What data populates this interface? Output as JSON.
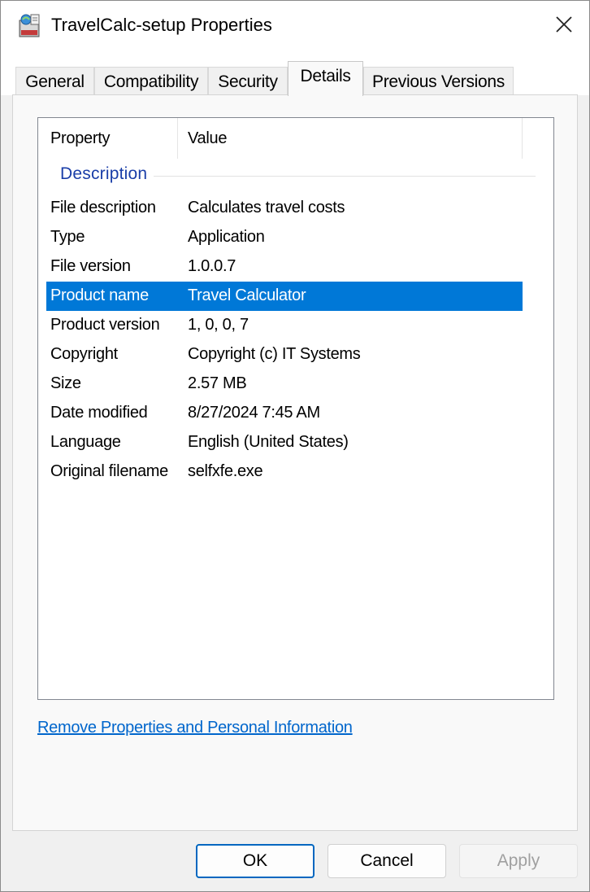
{
  "window": {
    "title": "TravelCalc-setup Properties"
  },
  "icons": {
    "app": "setup-package-icon",
    "close": "close-icon"
  },
  "tabs": [
    {
      "label": "General"
    },
    {
      "label": "Compatibility"
    },
    {
      "label": "Security"
    },
    {
      "label": "Details",
      "active": true
    },
    {
      "label": "Previous Versions"
    }
  ],
  "list": {
    "headers": {
      "property": "Property",
      "value": "Value"
    },
    "group": "Description",
    "selected_row": "Product name",
    "rows": [
      {
        "property": "File description",
        "value": "Calculates travel costs"
      },
      {
        "property": "Type",
        "value": "Application"
      },
      {
        "property": "File version",
        "value": "1.0.0.7"
      },
      {
        "property": "Product name",
        "value": "Travel Calculator"
      },
      {
        "property": "Product version",
        "value": "1, 0, 0, 7"
      },
      {
        "property": "Copyright",
        "value": "Copyright (c) IT Systems"
      },
      {
        "property": "Size",
        "value": "2.57 MB"
      },
      {
        "property": "Date modified",
        "value": "8/27/2024 7:45 AM"
      },
      {
        "property": "Language",
        "value": "English (United States)"
      },
      {
        "property": "Original filename",
        "value": "selfxfe.exe"
      }
    ]
  },
  "link": {
    "label": "Remove Properties and Personal Information"
  },
  "buttons": {
    "ok": "OK",
    "cancel": "Cancel",
    "apply": "Apply",
    "apply_enabled": false
  },
  "colors": {
    "selection": "#0078d7",
    "group_header": "#1a3ea8",
    "link": "#0066cc"
  }
}
